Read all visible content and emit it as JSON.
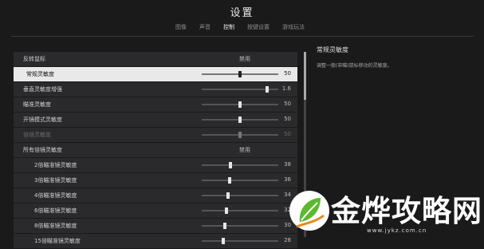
{
  "title": "设置",
  "tabs": [
    "图像",
    "声音",
    "控制",
    "按键设置",
    "游戏玩法"
  ],
  "active_tab": "控制",
  "rows": [
    {
      "label": "反转鼠标",
      "value": "禁用",
      "type": "text"
    },
    {
      "label": "常规灵敏度",
      "value": "50",
      "level": 0.5,
      "type": "slider",
      "active": true
    },
    {
      "label": "垂直灵敏度增强",
      "value": "1.6",
      "level": 0.85,
      "type": "slider"
    },
    {
      "label": "瞄准灵敏度",
      "value": "50",
      "level": 0.5,
      "type": "slider"
    },
    {
      "label": "开镜模式灵敏度",
      "value": "50",
      "level": 0.5,
      "type": "slider"
    },
    {
      "label": "倍镜灵敏度",
      "value": "50",
      "level": 0.5,
      "type": "slider",
      "dim": true
    },
    {
      "label": "所有倍镜灵敏度",
      "value": "禁用",
      "type": "text"
    },
    {
      "label": "2倍瞄准镜灵敏度",
      "value": "38",
      "level": 0.38,
      "type": "slider",
      "indent": true
    },
    {
      "label": "3倍瞄准镜灵敏度",
      "value": "36",
      "level": 0.36,
      "type": "slider",
      "indent": true
    },
    {
      "label": "4倍瞄准镜灵敏度",
      "value": "34",
      "level": 0.34,
      "type": "slider",
      "indent": true
    },
    {
      "label": "6倍瞄准镜灵敏度",
      "value": "32",
      "level": 0.32,
      "type": "slider",
      "indent": true
    },
    {
      "label": "8倍瞄准镜灵敏度",
      "value": "30",
      "level": 0.3,
      "type": "slider",
      "indent": true
    },
    {
      "label": "15倍瞄准镜灵敏度",
      "value": "28",
      "level": 0.28,
      "type": "slider",
      "indent": true
    }
  ],
  "description": {
    "title": "常规灵敏度",
    "body": "调整一般(非瞄)鼠标移动的灵敏度。"
  },
  "watermark": {
    "text": "金烨攻略网",
    "url": "www.jykz.com.cn"
  }
}
